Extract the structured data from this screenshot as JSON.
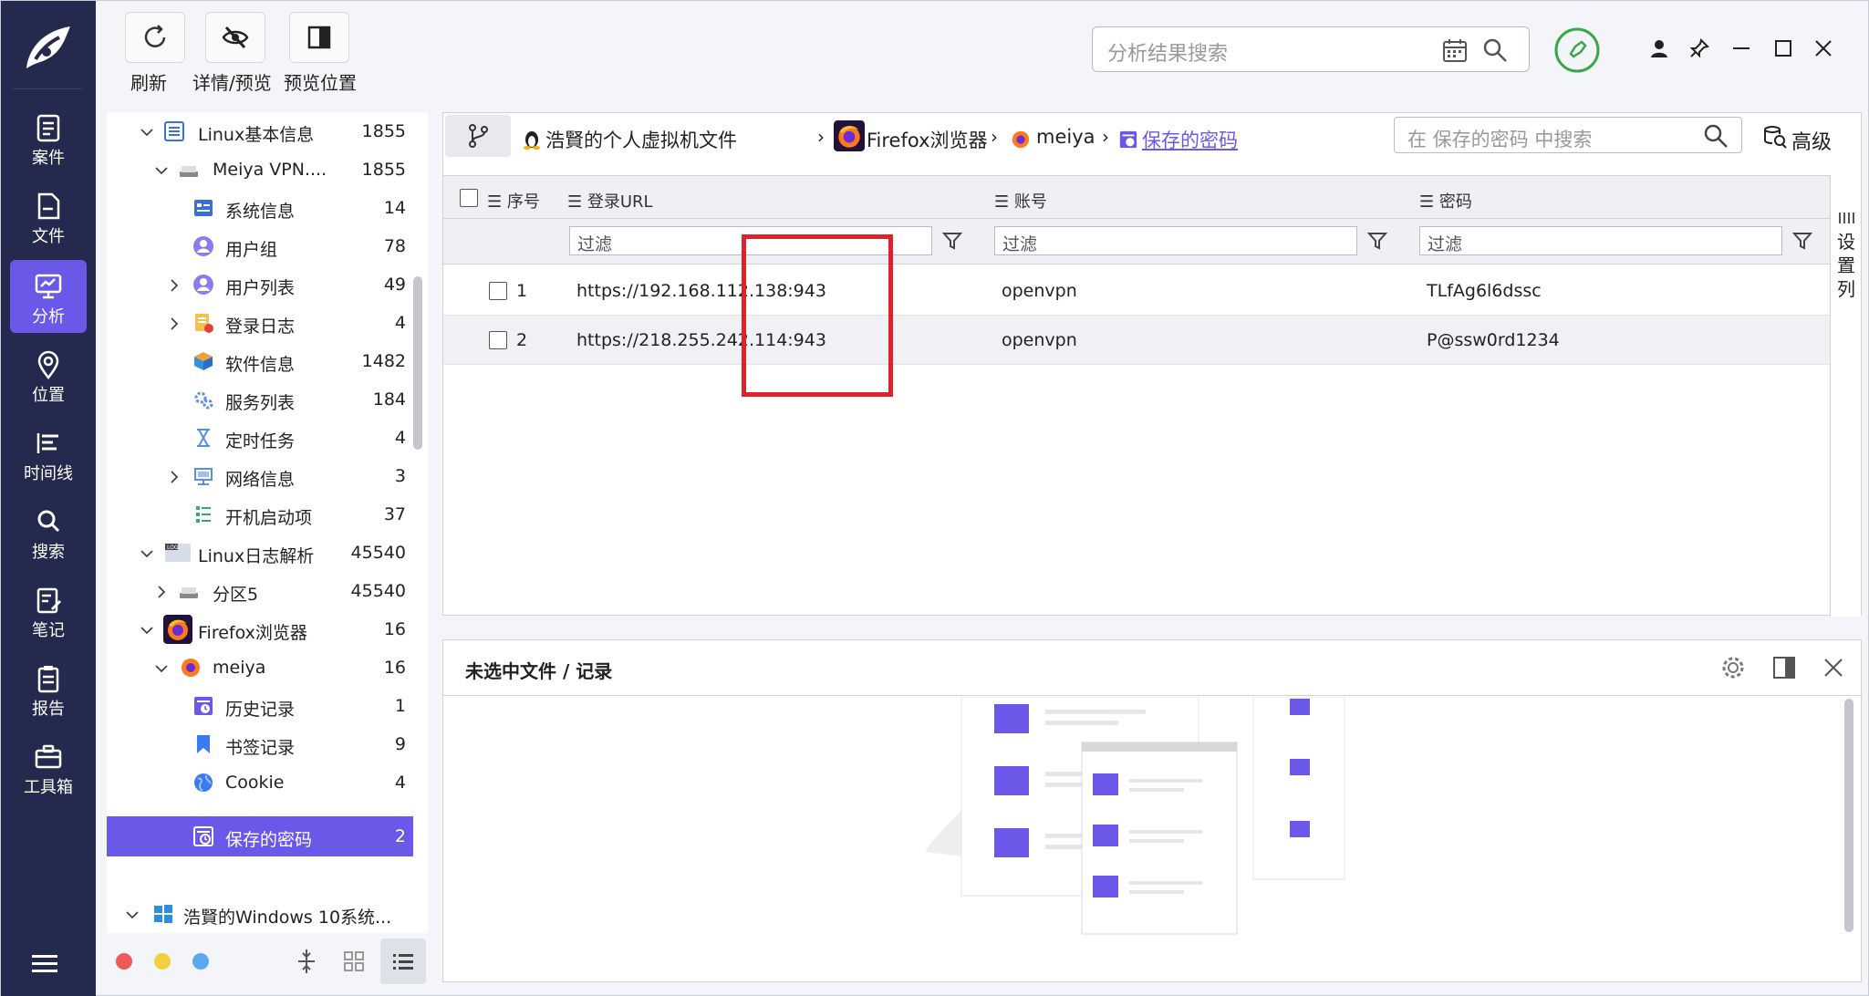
{
  "app": {
    "brand_color": "#6c58e8",
    "nav_bg": "#242a4d"
  },
  "nav": [
    {
      "label": "案件",
      "icon": "clipboard-icon"
    },
    {
      "label": "文件",
      "icon": "file-icon"
    },
    {
      "label": "分析",
      "icon": "monitor-icon",
      "active": true
    },
    {
      "label": "位置",
      "icon": "location-pin-icon"
    },
    {
      "label": "时间线",
      "icon": "timeline-icon"
    },
    {
      "label": "搜索",
      "icon": "search-icon"
    },
    {
      "label": "笔记",
      "icon": "note-icon"
    },
    {
      "label": "报告",
      "icon": "report-icon"
    },
    {
      "label": "工具箱",
      "icon": "toolbox-icon"
    }
  ],
  "toolbar": {
    "refresh_label": "刷新",
    "details_preview_label": "详情/预览",
    "preview_position_label": "预览位置",
    "search_placeholder": "分析结果搜索"
  },
  "tree": [
    {
      "label": "Linux基本信息",
      "count": "1855"
    },
    {
      "label": "Meiya VPN....",
      "count": "1855"
    },
    {
      "label": "系统信息",
      "count": "14"
    },
    {
      "label": "用户组",
      "count": "78"
    },
    {
      "label": "用户列表",
      "count": "49"
    },
    {
      "label": "登录日志",
      "count": "4"
    },
    {
      "label": "软件信息",
      "count": "1482"
    },
    {
      "label": "服务列表",
      "count": "184"
    },
    {
      "label": "定时任务",
      "count": "4"
    },
    {
      "label": "网络信息",
      "count": "3"
    },
    {
      "label": "开机启动项",
      "count": "37"
    },
    {
      "label": "Linux日志解析",
      "count": "45540"
    },
    {
      "label": "分区5",
      "count": "45540"
    },
    {
      "label": "Firefox浏览器",
      "count": "16"
    },
    {
      "label": "meiya",
      "count": "16"
    },
    {
      "label": "历史记录",
      "count": "1"
    },
    {
      "label": "书签记录",
      "count": "9"
    },
    {
      "label": "Cookie",
      "count": "4"
    },
    {
      "label": "保存的密码",
      "count": "2",
      "selected": true
    },
    {
      "label": "浩賢的Windows 10系统...",
      "count": ""
    }
  ],
  "breadcrumb": {
    "items": [
      "浩賢的个人虚拟机文件",
      "Firefox浏览器",
      "meiya",
      "保存的密码"
    ],
    "search_placeholder": "在 保存的密码 中搜索",
    "advanced_label": "高级"
  },
  "grid": {
    "columns": [
      "序号",
      "登录URL",
      "账号",
      "密码"
    ],
    "filter_placeholder": "过滤",
    "rows": [
      {
        "index": "1",
        "url": "https://192.168.112.138:943",
        "account": "openvpn",
        "password": "TLfAg6l6dssc"
      },
      {
        "index": "2",
        "url": "https://218.255.242.114:943",
        "account": "openvpn",
        "password": "P@ssw0rd1234"
      }
    ],
    "column_settings_label": "设置列"
  },
  "preview": {
    "title": "未选中文件 / 记录"
  }
}
